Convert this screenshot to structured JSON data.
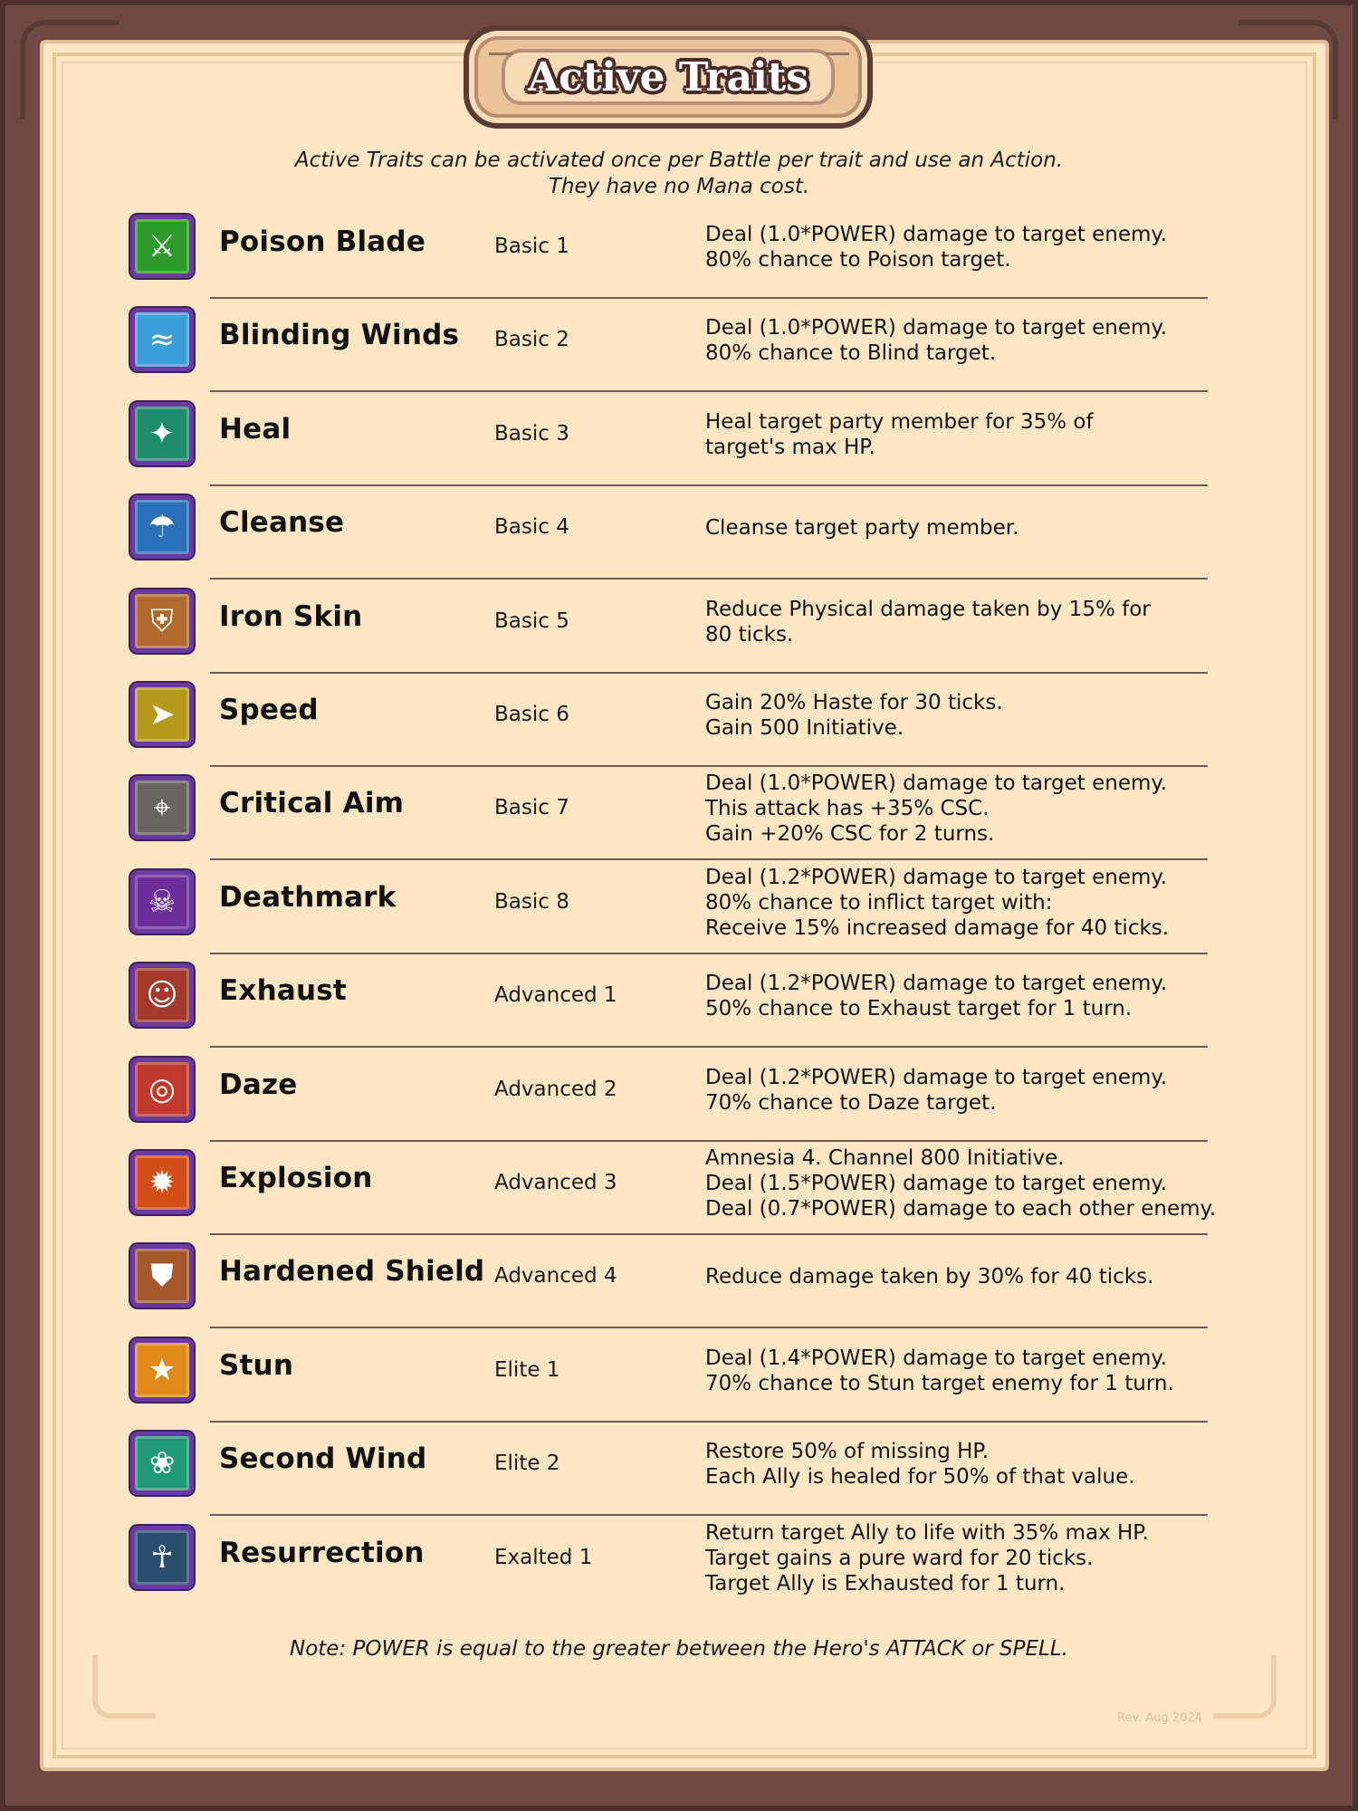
{
  "title": "Active Traits",
  "subtitle": {
    "line1": "Active Traits can be activated once per Battle per trait and use an Action.",
    "line2": "They have no Mana cost."
  },
  "traits": [
    {
      "name": "Poison Blade",
      "tier": "Basic 1",
      "icon": "poison-blade-icon",
      "icon_color": "#2e9a2a",
      "description": [
        "Deal (1.0*POWER) damage to target enemy.",
        "80% chance to Poison target."
      ]
    },
    {
      "name": "Blinding Winds",
      "tier": "Basic 2",
      "icon": "blinding-winds-icon",
      "icon_color": "#3e9fd8",
      "description": [
        "Deal (1.0*POWER) damage to target enemy.",
        "80% chance to Blind target."
      ]
    },
    {
      "name": "Heal",
      "tier": "Basic 3",
      "icon": "heal-icon",
      "icon_color": "#1f8c6e",
      "description": [
        "Heal target party member for 35% of",
        "target's max HP."
      ]
    },
    {
      "name": "Cleanse",
      "tier": "Basic 4",
      "icon": "cleanse-icon",
      "icon_color": "#2a6fb7",
      "description": [
        "Cleanse target party member."
      ]
    },
    {
      "name": "Iron Skin",
      "tier": "Basic 5",
      "icon": "iron-skin-icon",
      "icon_color": "#b06a2e",
      "description": [
        "Reduce Physical damage taken by 15% for",
        "80 ticks."
      ]
    },
    {
      "name": "Speed",
      "tier": "Basic 6",
      "icon": "speed-icon",
      "icon_color": "#b59a1c",
      "description": [
        "Gain 20% Haste for 30 ticks.",
        "Gain 500 Initiative."
      ]
    },
    {
      "name": "Critical Aim",
      "tier": "Basic 7",
      "icon": "critical-aim-icon",
      "icon_color": "#6b6460",
      "description": [
        "Deal (1.0*POWER) damage to target enemy.",
        "This attack has +35% CSC.",
        "Gain +20% CSC for 2 turns."
      ]
    },
    {
      "name": "Deathmark",
      "tier": "Basic 8",
      "icon": "deathmark-icon",
      "icon_color": "#6d2d9a",
      "description": [
        "Deal (1.2*POWER) damage to target enemy.",
        "80% chance to inflict target with:",
        "Receive 15% increased damage for 40 ticks."
      ]
    },
    {
      "name": "Exhaust",
      "tier": "Advanced 1",
      "icon": "exhaust-icon",
      "icon_color": "#a33a2c",
      "description": [
        "Deal (1.2*POWER) damage to target enemy.",
        "50% chance to Exhaust target for 1 turn."
      ]
    },
    {
      "name": "Daze",
      "tier": "Advanced 2",
      "icon": "daze-icon",
      "icon_color": "#c23a2c",
      "description": [
        "Deal (1.2*POWER) damage to target enemy.",
        "70% chance to Daze target."
      ]
    },
    {
      "name": "Explosion",
      "tier": "Advanced 3",
      "icon": "explosion-icon",
      "icon_color": "#d24f1a",
      "description": [
        "Amnesia 4. Channel 800 Initiative.",
        "Deal (1.5*POWER) damage to target enemy.",
        "Deal (0.7*POWER) damage to each other enemy."
      ]
    },
    {
      "name": "Hardened Shield",
      "tier": "Advanced 4",
      "icon": "hardened-shield-icon",
      "icon_color": "#a5582c",
      "description": [
        "Reduce damage taken by 30% for 40 ticks."
      ]
    },
    {
      "name": "Stun",
      "tier": "Elite 1",
      "icon": "stun-icon",
      "icon_color": "#e08a1c",
      "description": [
        "Deal (1.4*POWER) damage to target enemy.",
        "70% chance to Stun target enemy for 1 turn."
      ]
    },
    {
      "name": "Second Wind",
      "tier": "Elite 2",
      "icon": "second-wind-icon",
      "icon_color": "#1f9a78",
      "description": [
        "Restore 50% of missing HP.",
        "Each Ally is healed for 50% of that value."
      ]
    },
    {
      "name": "Resurrection",
      "tier": "Exalted 1",
      "icon": "resurrection-icon",
      "icon_color": "#2a4e6e",
      "description": [
        "Return target Ally to life with 35% max HP.",
        "Target gains a pure ward for 20 ticks.",
        "Target Ally is Exhausted for 1 turn."
      ]
    }
  ],
  "note": "Note: POWER is equal to the greater between the Hero's ATTACK or SPELL.",
  "revision": "Rev. Aug 2024"
}
